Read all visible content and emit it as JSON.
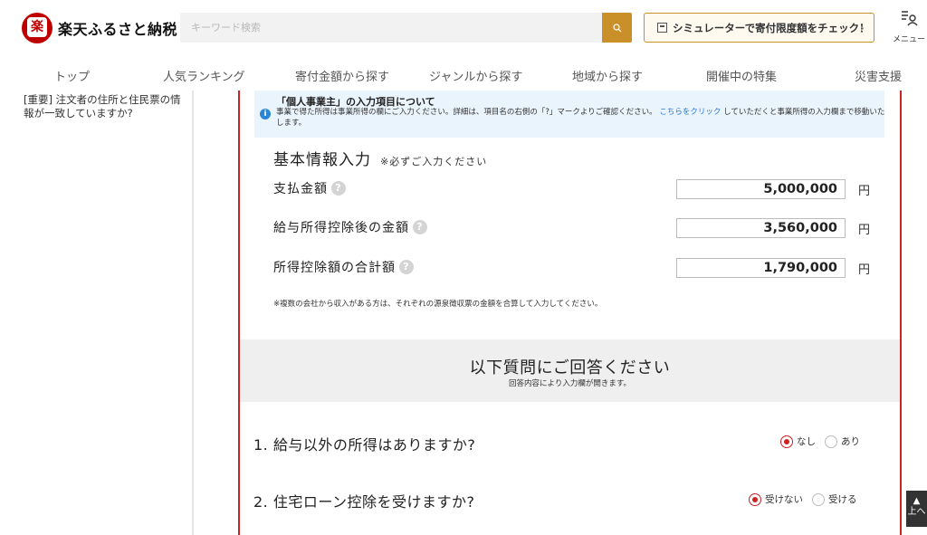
{
  "header": {
    "logo_text": "楽天ふるさと納税",
    "logo_mark_char": "楽",
    "search_placeholder": "キーワード検索",
    "simulator_label": "シミュレーターで寄付限度額をチェック！",
    "menu_label": "メニュー"
  },
  "nav": {
    "items": [
      "トップ",
      "人気ランキング",
      "寄付金額から探す",
      "ジャンルから探す",
      "地域から探す",
      "開催中の特集",
      "災害支援"
    ]
  },
  "sidebar": {
    "text": "[重要] 注文者の住所と住民票の情報が一致していますか?"
  },
  "info": {
    "title": "「個人事業主」の入力項目について",
    "body_before": "事業で得た所得は事業所得の欄にご入力ください。詳細は、項目名の右側の「?」マークよりご確認ください。",
    "link": "こちらをクリック",
    "body_after": " していただくと事業所得の入力欄まで移動いたします。"
  },
  "basic": {
    "title": "基本情報入力",
    "required_note": "※必ずご入力ください",
    "rows": [
      {
        "label": "支払金額",
        "value": "5,000,000",
        "unit": "円"
      },
      {
        "label": "給与所得控除後の金額",
        "value": "3,560,000",
        "unit": "円"
      },
      {
        "label": "所得控除額の合計額",
        "value": "1,790,000",
        "unit": "円"
      }
    ],
    "note": "※複数の会社から収入がある方は、それぞれの源泉徴収票の金額を合算して入力してください。"
  },
  "questions_band": {
    "title": "以下質問にご回答ください",
    "subtitle": "回答内容により入力欄が開きます。"
  },
  "questions": [
    {
      "text": "1. 給与以外の所得はありますか?",
      "options": [
        "なし",
        "あり"
      ],
      "selected": "なし"
    },
    {
      "text": "2. 住宅ローン控除を受けますか?",
      "options": [
        "受けない",
        "受ける"
      ],
      "selected": "受けない"
    }
  ],
  "to_top_label": "上へ",
  "colors": {
    "accent_gold": "#c9902a",
    "brand_red": "#bf0000",
    "info_blue": "#2a85d5"
  }
}
